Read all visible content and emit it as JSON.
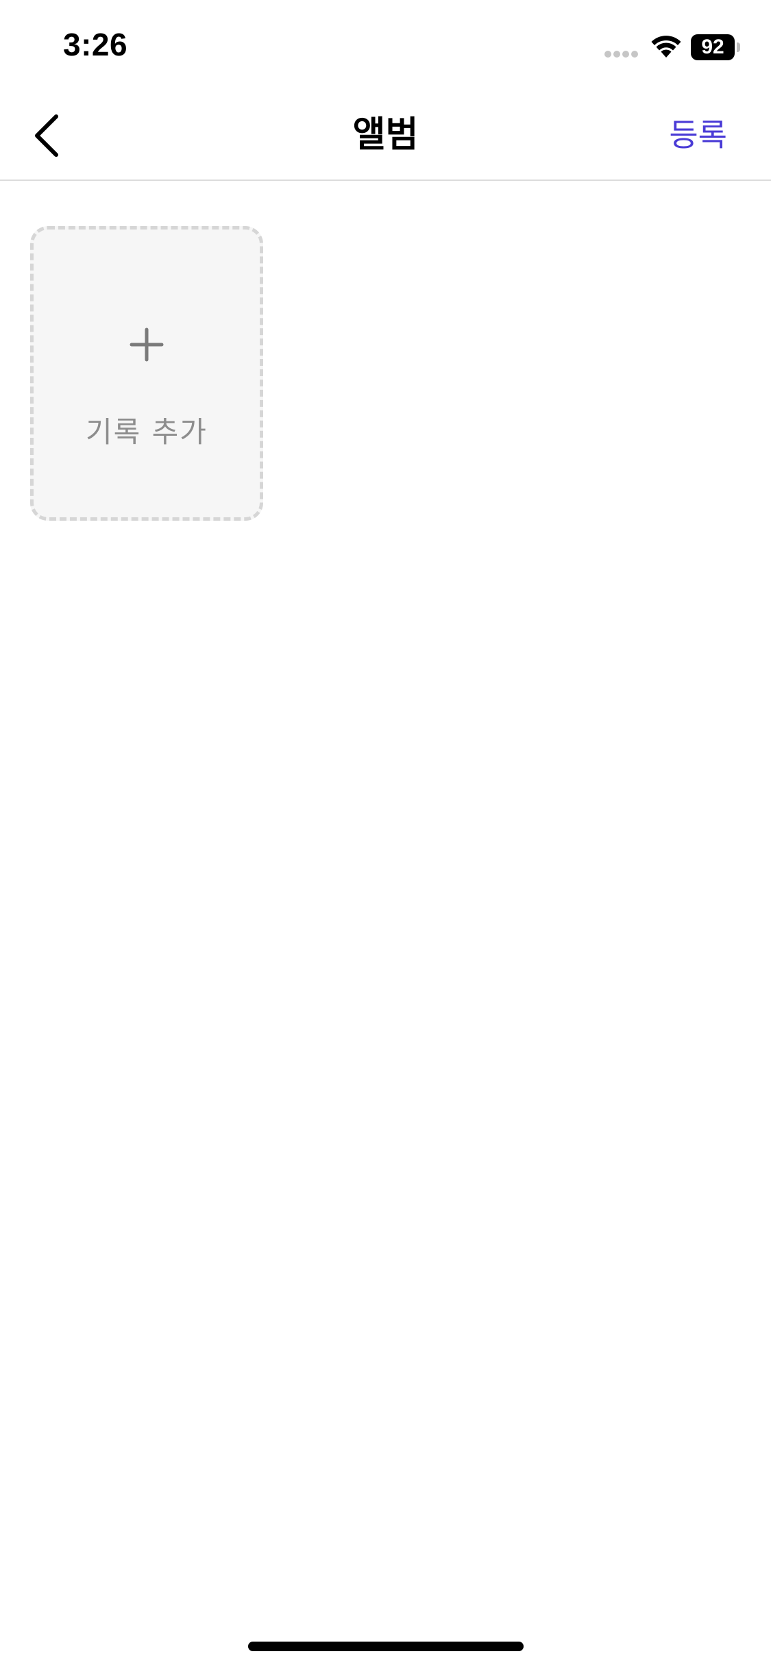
{
  "status_bar": {
    "time": "3:26",
    "battery_level": "92",
    "cellular_icon": "cellular-signal-icon",
    "wifi_icon": "wifi-icon",
    "battery_icon": "battery-icon"
  },
  "nav": {
    "back_icon": "chevron-left-icon",
    "title": "앨범",
    "register_label": "등록",
    "register_color": "#4a3bd6"
  },
  "content": {
    "add_card": {
      "icon": "plus-icon",
      "label": "기록 추가"
    }
  }
}
